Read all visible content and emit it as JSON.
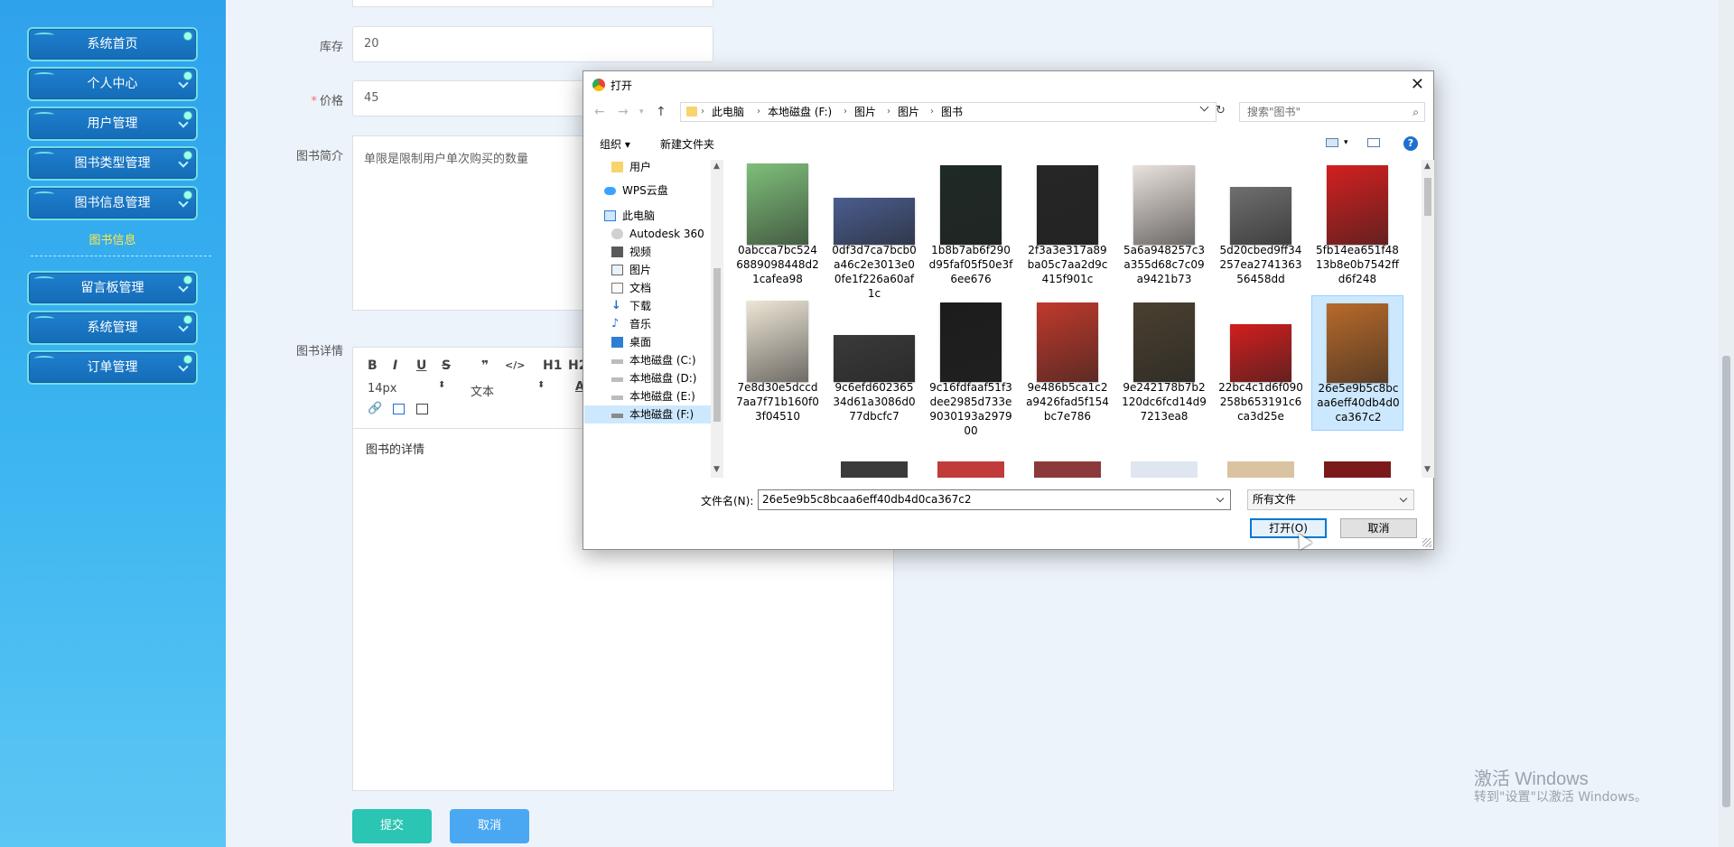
{
  "sidebar": {
    "items": [
      {
        "label": "系统首页"
      },
      {
        "label": "个人中心"
      },
      {
        "label": "用户管理"
      },
      {
        "label": "图书类型管理"
      },
      {
        "label": "图书信息管理"
      },
      {
        "label": "留言板管理"
      },
      {
        "label": "系统管理"
      },
      {
        "label": "订单管理"
      }
    ],
    "sub_item": "图书信息"
  },
  "form": {
    "stock_label": "库存",
    "stock_value": "20",
    "price_required": "*",
    "price_label": "价格",
    "price_value": "45",
    "intro_label": "图书简介",
    "intro_value": "单限是限制用户单次购买的数量",
    "detail_label": "图书详情",
    "editor": {
      "font_size": "14px",
      "font_family": "文本",
      "content": "图书的详情",
      "h1": "H1",
      "h2": "H2",
      "bold": "B",
      "italic": "I",
      "underline": "U",
      "strike": "S",
      "quote": "❞",
      "code": "</>"
    },
    "submit_label": "提交",
    "cancel_label": "取消"
  },
  "watermark": {
    "line1": "激活 Windows",
    "line2": "转到\"设置\"以激活 Windows。"
  },
  "dialog": {
    "title": "打开",
    "breadcrumbs": [
      "此电脑",
      "本地磁盘 (F:)",
      "图片",
      "图片",
      "图书"
    ],
    "search_placeholder": "搜索\"图书\"",
    "toolbar": {
      "organize": "组织 ▾",
      "new_folder": "新建文件夹"
    },
    "tree": [
      {
        "label": "用户",
        "icon": "folder-icon"
      },
      {
        "label": "WPS云盘",
        "icon": "cloud-icon"
      },
      {
        "label": "此电脑",
        "icon": "computer-icon"
      },
      {
        "label": "Autodesk 360",
        "icon": "autodesk-icon"
      },
      {
        "label": "视频",
        "icon": "video-folder-icon"
      },
      {
        "label": "图片",
        "icon": "pictures-folder-icon"
      },
      {
        "label": "文档",
        "icon": "documents-folder-icon"
      },
      {
        "label": "下载",
        "icon": "download-folder-icon"
      },
      {
        "label": "音乐",
        "icon": "music-folder-icon"
      },
      {
        "label": "桌面",
        "icon": "desktop-folder-icon"
      },
      {
        "label": "本地磁盘 (C:)",
        "icon": "drive-icon"
      },
      {
        "label": "本地磁盘 (D:)",
        "icon": "drive-icon"
      },
      {
        "label": "本地磁盘 (E:)",
        "icon": "drive-icon"
      },
      {
        "label": "本地磁盘 (F:)",
        "icon": "drive-icon"
      }
    ],
    "files": [
      {
        "name": "0abcca7bc5246889098448d21cafea98",
        "color": "#7fbf7a"
      },
      {
        "name": "0df3d7ca7bcb0a46c2e3013e00fe1f226a60af1c",
        "color": "#4a5d8f"
      },
      {
        "name": "1b8b7ab6f290d95faf05f50e3f6ee676",
        "color": "#1e2a26"
      },
      {
        "name": "2f3a3e317a89ba05c7aa2d9c415f901c",
        "color": "#262626"
      },
      {
        "name": "5a6a948257c3a355d68c7c09a9421b73",
        "color": "#e9e1dc"
      },
      {
        "name": "5d20cbed9ff34257ea274136356458dd",
        "color": "#6f6f6f"
      },
      {
        "name": "5fb14ea651f4813b8e0b7542ffd6f248",
        "color": "#d41f1f"
      },
      {
        "name": "7e8d30e5dccd7aa7f71b160f03f04510",
        "color": "#ede6d6"
      },
      {
        "name": "9c6efd60236534d61a3086d077dbcfc7",
        "color": "#3a3a3a"
      },
      {
        "name": "9c16fdfaaf51f3dee2985d733e9030193a297900",
        "color": "#1c1c1c"
      },
      {
        "name": "9e486b5ca1c2a9426fad5f154bc7e786",
        "color": "#c0392b"
      },
      {
        "name": "9e242178b7b2120dc6fcd14d97213ea8",
        "color": "#4a4030"
      },
      {
        "name": "22bc4c1d6f090258b653191c6ca3d25e",
        "color": "#d21e1e"
      },
      {
        "name": "26e5e9b5c8bcaa6eff40db4d0ca367c2",
        "color": "#b86a2a"
      }
    ],
    "selected_file": "26e5e9b5c8bcaa6eff40db4d0ca367c2",
    "filename_label": "文件名(N):",
    "filename_value": "26e5e9b5c8bcaa6eff40db4d0ca367c2",
    "filetype_value": "所有文件",
    "open_label": "打开(O)",
    "cancel_label": "取消"
  }
}
